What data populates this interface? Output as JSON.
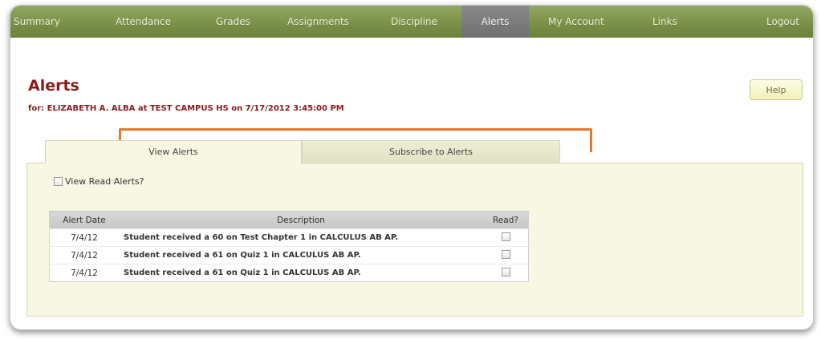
{
  "nav": {
    "items": [
      {
        "label": "Summary",
        "active": false
      },
      {
        "label": "Attendance",
        "active": false
      },
      {
        "label": "Grades",
        "active": false
      },
      {
        "label": "Assignments",
        "active": false
      },
      {
        "label": "Discipline",
        "active": false
      },
      {
        "label": "Alerts",
        "active": true
      },
      {
        "label": "My Account",
        "active": false
      },
      {
        "label": "Links",
        "active": false
      },
      {
        "label": "Logout",
        "active": false
      }
    ]
  },
  "header": {
    "title": "Alerts",
    "subtitle": "for: ELIZABETH A. ALBA at TEST CAMPUS HS on 7/17/2012 3:45:00 PM",
    "help_label": "Help"
  },
  "tabs": [
    {
      "label": "View Alerts",
      "active": true
    },
    {
      "label": "Subscribe to Alerts",
      "active": false
    }
  ],
  "filters": {
    "view_read_label": "View Read Alerts?",
    "view_read_checked": false
  },
  "table": {
    "headers": {
      "date": "Alert Date",
      "description": "Description",
      "read": "Read?"
    },
    "rows": [
      {
        "date": "7/4/12",
        "description": "Student received a 60 on Test Chapter 1 in CALCULUS AB AP.",
        "read": false
      },
      {
        "date": "7/4/12",
        "description": "Student received a 61 on Quiz 1 in CALCULUS AB AP.",
        "read": false
      },
      {
        "date": "7/4/12",
        "description": "Student received a 61 on Quiz 1 in CALCULUS AB AP.",
        "read": false
      }
    ]
  },
  "colors": {
    "nav_green": "#7b9148",
    "title_red": "#8b1a1a",
    "panel_bg": "#f7f7e4",
    "callout_orange": "#e07a2e"
  }
}
